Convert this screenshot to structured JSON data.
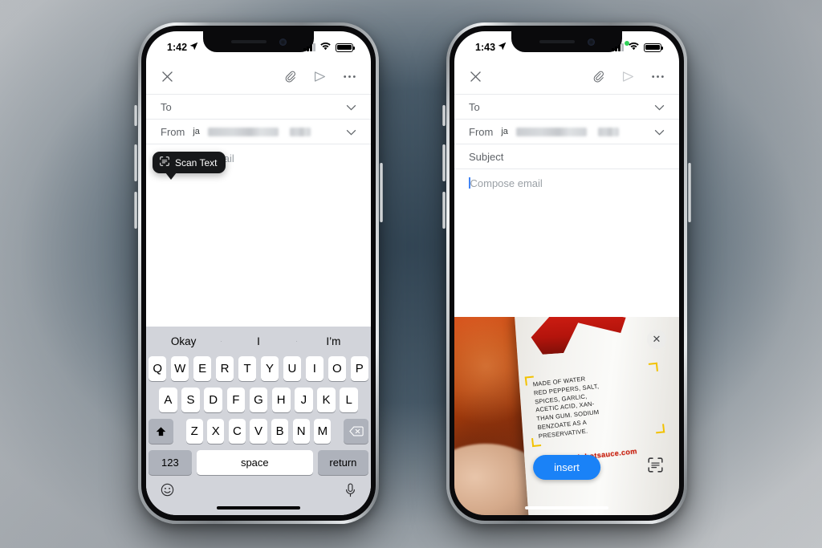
{
  "background": {
    "accent_dark": "#36485a",
    "accent_light": "#b8bcc0"
  },
  "phones": [
    {
      "id": "left",
      "status_bar": {
        "time": "1:42",
        "location_icon": "location-arrow-icon",
        "signal_icon": "cellular-bars-icon",
        "wifi_icon": "wifi-icon",
        "battery_icon": "battery-icon",
        "camera_active_dot": false
      },
      "compose": {
        "close_label": "✕",
        "attach_icon": "paperclip-icon",
        "send_icon": "send-icon",
        "more_icon": "more-options-icon",
        "to_label": "To",
        "from_label": "From",
        "from_value_prefix": "ja",
        "expand_icon": "chevron-down-icon",
        "subject_label": "",
        "body_placeholder": "Compose email"
      },
      "tooltip": {
        "label": "Scan Text",
        "icon": "scan-text-icon"
      },
      "keyboard": {
        "predictions": [
          "Okay",
          "I",
          "I’m"
        ],
        "row1": [
          "Q",
          "W",
          "E",
          "R",
          "T",
          "Y",
          "U",
          "I",
          "O",
          "P"
        ],
        "row2": [
          "A",
          "S",
          "D",
          "F",
          "G",
          "H",
          "J",
          "K",
          "L"
        ],
        "row3": [
          "Z",
          "X",
          "C",
          "V",
          "B",
          "N",
          "M"
        ],
        "shift_label": "⬆",
        "backspace_label": "⌫",
        "numbers_label": "123",
        "space_label": "space",
        "return_label": "return",
        "emoji_icon": "emoji-icon",
        "dictation_icon": "microphone-icon"
      }
    },
    {
      "id": "right",
      "status_bar": {
        "time": "1:43",
        "location_icon": "location-arrow-icon",
        "signal_icon": "cellular-bars-icon",
        "wifi_icon": "wifi-icon",
        "battery_icon": "battery-icon",
        "camera_active_dot": true
      },
      "compose": {
        "close_label": "✕",
        "attach_icon": "paperclip-icon",
        "send_icon": "send-icon",
        "more_icon": "more-options-icon",
        "to_label": "To",
        "from_label": "From",
        "from_value_prefix": "ja",
        "expand_icon": "chevron-down-icon",
        "subject_label": "Subject",
        "body_placeholder": "Compose email"
      },
      "camera": {
        "close_label": "✕",
        "insert_label": "insert",
        "scan_toggle_icon": "scan-text-icon",
        "detected_text_lines": [
          "MADE OF WATER",
          "RED PEPPERS, SALT,",
          "SPICES, GARLIC,",
          "ACETIC ACID, XAN-",
          "THAN GUM. SODIUM",
          "BENZOATE AS A",
          "PRESERVATIVE."
        ],
        "url_text": "www.tapatiohotsauce.com",
        "highlight_color": "#f2c200",
        "insert_button_color": "#1a82f7"
      }
    }
  ]
}
